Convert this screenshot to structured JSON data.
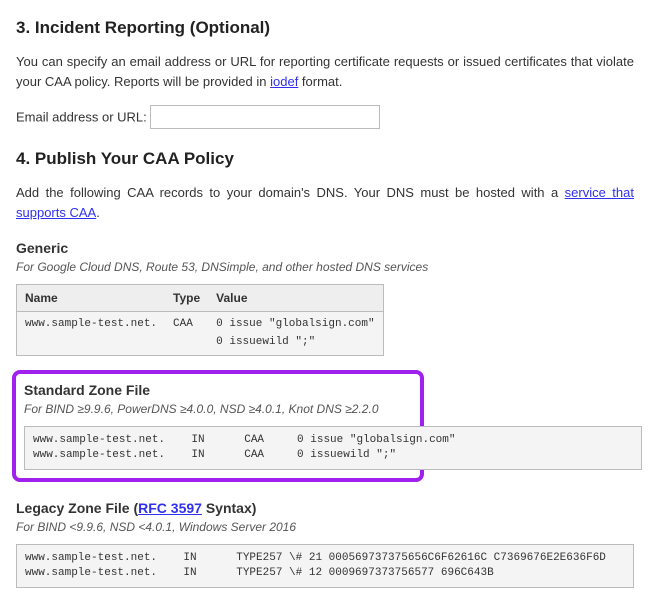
{
  "section3": {
    "heading": "3. Incident Reporting (Optional)",
    "body_a": "You can specify an email address or URL for reporting certificate requests or issued certificates that violate your CAA policy. Reports will be provided in ",
    "link_text": "iodef",
    "body_b": " format.",
    "field_label": "Email address or URL:",
    "field_value": ""
  },
  "section4": {
    "heading": "4. Publish Your CAA Policy",
    "body_a": "Add the following CAA records to your domain's DNS. Your DNS must be hosted with a ",
    "link_text": "service that supports CAA",
    "body_b": "."
  },
  "generic": {
    "title": "Generic",
    "subtitle": "For Google Cloud DNS, Route 53, DNSimple, and other hosted DNS services",
    "columns": {
      "name": "Name",
      "type": "Type",
      "value": "Value"
    },
    "row": {
      "name": "www.sample-test.net.",
      "type": "CAA",
      "value_line1": "0 issue \"globalsign.com\"",
      "value_line2": "0 issuewild \";\""
    }
  },
  "standard": {
    "title": "Standard Zone File",
    "subtitle": "For BIND ≥9.9.6, PowerDNS ≥4.0.0, NSD ≥4.0.1, Knot DNS ≥2.2.0",
    "text": "www.sample-test.net.    IN      CAA     0 issue \"globalsign.com\"\nwww.sample-test.net.    IN      CAA     0 issuewild \";\""
  },
  "legacy": {
    "title_a": "Legacy Zone File (",
    "rfc_link": "RFC 3597",
    "title_b": " Syntax)",
    "subtitle": "For BIND <9.9.6, NSD <4.0.1, Windows Server 2016",
    "text": "www.sample-test.net.    IN      TYPE257 \\# 21 000569737375656C6F62616C C7369676E2E636F6D\nwww.sample-test.net.    IN      TYPE257 \\# 12 0009697373756577 696C643B"
  }
}
